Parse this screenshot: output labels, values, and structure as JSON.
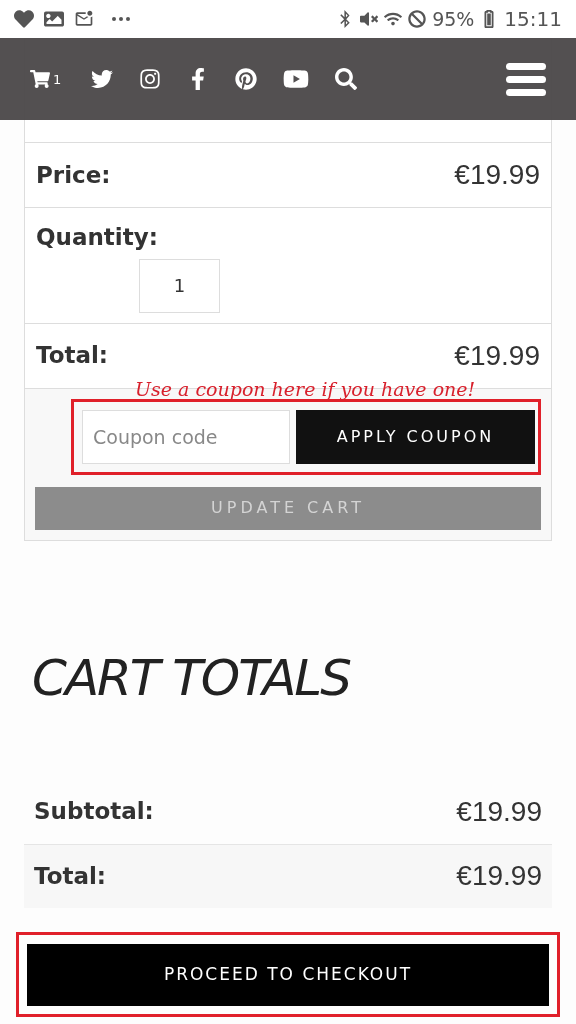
{
  "status_bar": {
    "battery": "95%",
    "time": "15:11"
  },
  "header": {
    "cart_count": "1"
  },
  "cart_table": {
    "rows": [
      {
        "kind": "amount",
        "label": "Price:",
        "value": "€19.99"
      },
      {
        "kind": "quantity",
        "label": "Quantity:",
        "value": "1"
      },
      {
        "kind": "amount",
        "label": "Total:",
        "value": "€19.99"
      }
    ],
    "annotation": "Use a coupon here if you have one!",
    "coupon": {
      "placeholder": "Coupon code",
      "button": "APPLY COUPON"
    },
    "update_cart": {
      "label": "UPDATE CART",
      "disabled": true
    }
  },
  "cart_totals": {
    "title": "CART TOTALS",
    "rows": [
      {
        "label": "Subtotal:",
        "value": "€19.99",
        "shaded": false
      },
      {
        "label": "Total:",
        "value": "€19.99",
        "shaded": true
      }
    ]
  },
  "checkout_button": "PROCEED TO CHECKOUT"
}
